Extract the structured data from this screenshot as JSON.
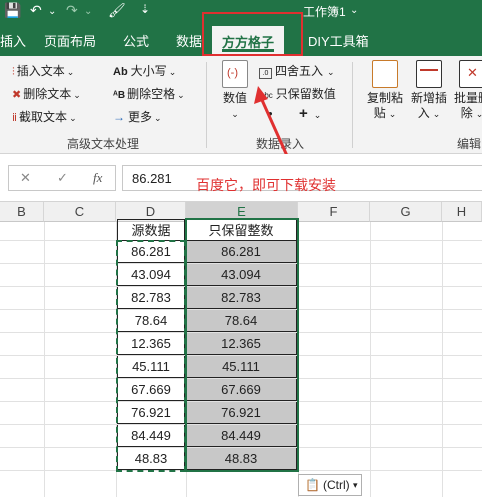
{
  "window": {
    "title": "工作簿1",
    "title_caret": "⌄"
  },
  "quick_access": {
    "save": "💾",
    "undo": "↶",
    "undo_drop": "⌄",
    "redo": "↷",
    "redo_drop": "⌄",
    "format_painter": "🖌",
    "customize": "⇣"
  },
  "tabs": [
    "插入",
    "页面布局",
    "公式",
    "数据",
    "方方格子",
    "DIY工具箱"
  ],
  "active_tab": "方方格子",
  "ribbon": {
    "text_group": {
      "insert_text": "插入文本",
      "delete_text": "删除文本",
      "extract_text": "截取文本",
      "case": "大小写",
      "delete_spaces": "删除空格",
      "more": "更多",
      "label": "高级文本处理"
    },
    "number_group": {
      "numeric": "数值",
      "round": "四舍五入",
      "keep_value": "只保留数值",
      "plus": "+",
      "dot": "•",
      "label": "数据录入"
    },
    "copy_paste": {
      "line1": "复制粘",
      "line2": "贴"
    },
    "new_insert": {
      "line1": "新增插",
      "line2": "入"
    },
    "batch_delete": {
      "line1": "批量删",
      "line2": "除"
    },
    "edit_label": "编辑"
  },
  "formula_bar": {
    "cancel": "✕",
    "confirm": "✓",
    "fx": "fx",
    "value": "86.281"
  },
  "annotation": "百度它，即可下载安装",
  "columns": [
    "B",
    "C",
    "D",
    "E",
    "F",
    "G",
    "H"
  ],
  "table": {
    "header_d": "源数据",
    "header_e": "只保留整数",
    "rows": [
      {
        "d": "86.281",
        "e": "86.281"
      },
      {
        "d": "43.094",
        "e": "43.094"
      },
      {
        "d": "82.783",
        "e": "82.783"
      },
      {
        "d": "78.64",
        "e": "78.64"
      },
      {
        "d": "12.365",
        "e": "12.365"
      },
      {
        "d": "45.111",
        "e": "45.111"
      },
      {
        "d": "67.669",
        "e": "67.669"
      },
      {
        "d": "76.921",
        "e": "76.921"
      },
      {
        "d": "84.449",
        "e": "84.449"
      },
      {
        "d": "48.83",
        "e": "48.83"
      }
    ]
  },
  "paste_options": {
    "label": "(Ctrl)",
    "caret": "▾"
  },
  "colors": {
    "excel_green": "#217346",
    "annotation_red": "#e03030",
    "selection_fill": "#c8c8c8"
  }
}
